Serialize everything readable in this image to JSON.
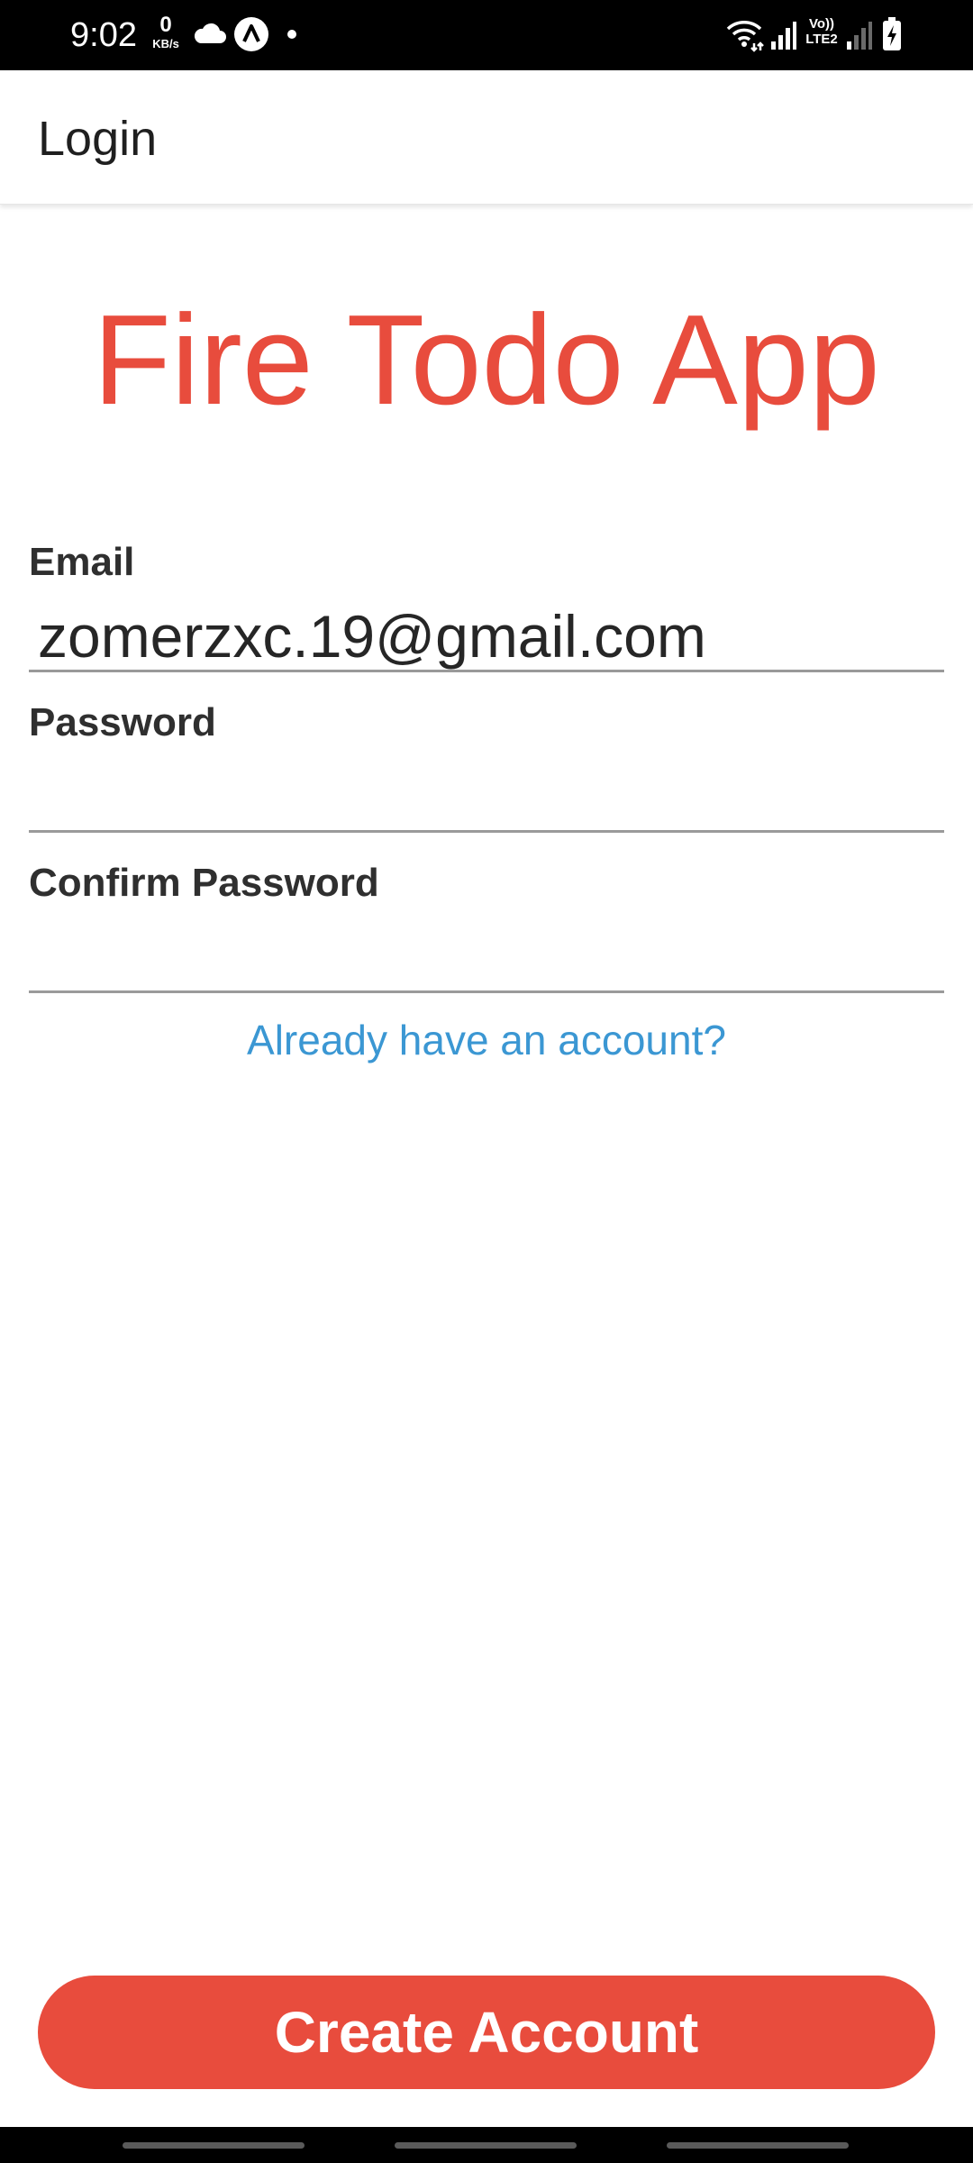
{
  "status_bar": {
    "time": "9:02",
    "net_speed_value": "0",
    "net_speed_unit": "KB/s",
    "volte_label_top": "Vo))",
    "volte_label_bottom": "LTE2",
    "icons": [
      "cloud-icon",
      "app-notification-icon",
      "dot-icon",
      "wifi-icon",
      "signal-icon",
      "signal-weak-icon",
      "battery-charging-icon"
    ]
  },
  "app_bar": {
    "title": "Login"
  },
  "main": {
    "app_title": "Fire Todo App",
    "email_label": "Email",
    "email_value": "zomerzxc.19@gmail.com",
    "password_label": "Password",
    "password_value": "",
    "confirm_password_label": "Confirm Password",
    "confirm_password_value": "",
    "login_link": "Already have an account?",
    "create_button": "Create Account"
  },
  "colors": {
    "accent": "#e84c3d",
    "link": "#3b97d3",
    "status_bar": "#000000"
  }
}
